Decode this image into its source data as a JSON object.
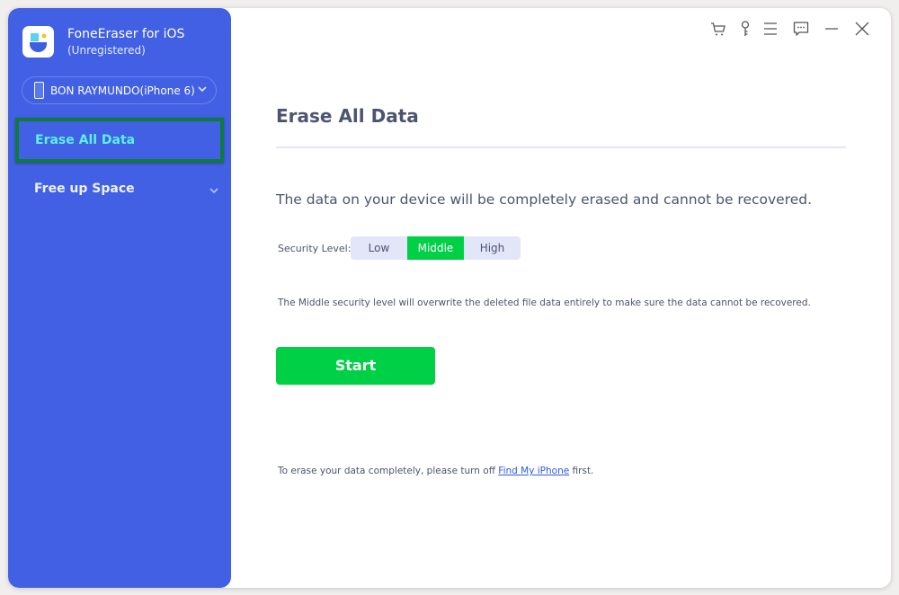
{
  "app": {
    "title": "FoneEraser for iOS",
    "subtitle": "(Unregistered)",
    "logo_icon": "foneeraser-logo-icon"
  },
  "device": {
    "name": "BON RAYMUNDO(iPhone 6)",
    "icon": "phone-icon"
  },
  "sidebar": {
    "items": [
      {
        "label": "Erase All Data",
        "active": true
      },
      {
        "label": "Free up Space",
        "active": false,
        "has_submenu": true
      }
    ]
  },
  "topbar": {
    "icons": [
      "cart-icon",
      "key-icon",
      "menu-icon",
      "feedback-icon",
      "minimize-icon",
      "close-icon"
    ]
  },
  "main": {
    "title": "Erase All Data",
    "description": "The data on your device will be completely erased and cannot be recovered.",
    "security": {
      "label": "Security Level:",
      "options": [
        "Low",
        "Middle",
        "High"
      ],
      "selected": "Middle"
    },
    "note": "The Middle security level will overwrite the deleted file data entirely to make sure the data cannot be recovered.",
    "start_label": "Start",
    "footer": {
      "prefix": "To erase your data completely, please turn off ",
      "link": "Find My iPhone",
      "suffix": " first."
    }
  },
  "colors": {
    "sidebar": "#4160e4",
    "accent_green": "#00d046",
    "active_text": "#5af2e8",
    "highlight_border": "#0f7a3b",
    "link": "#2e5be0"
  }
}
